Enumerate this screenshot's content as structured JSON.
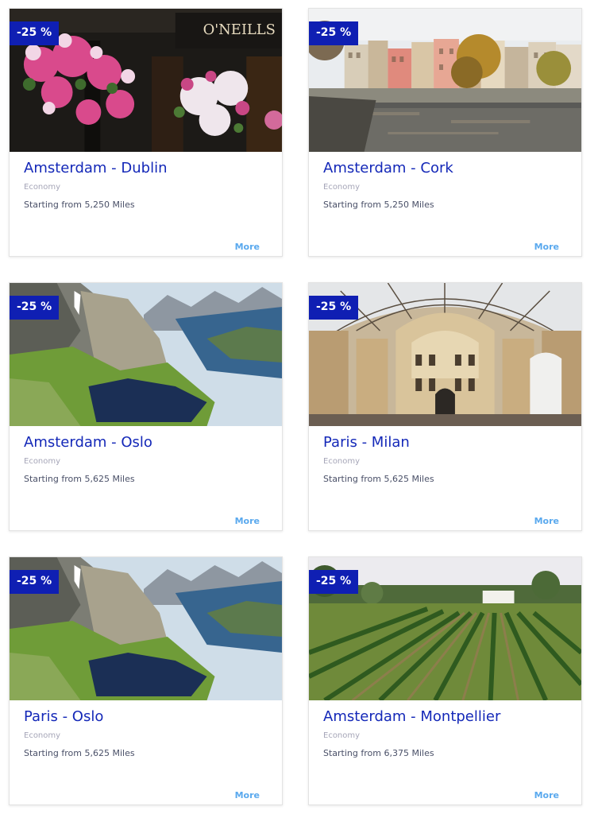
{
  "cards": [
    {
      "discount": "-25 %",
      "route": "Amsterdam - Dublin",
      "cabin": "Economy",
      "price": "Starting from 5,250 Miles",
      "more": "More",
      "sign": "O'NEILLS"
    },
    {
      "discount": "-25 %",
      "route": "Amsterdam - Cork",
      "cabin": "Economy",
      "price": "Starting from 5,250 Miles",
      "more": "More"
    },
    {
      "discount": "-25 %",
      "route": "Amsterdam - Oslo",
      "cabin": "Economy",
      "price": "Starting from 5,625 Miles",
      "more": "More"
    },
    {
      "discount": "-25 %",
      "route": "Paris - Milan",
      "cabin": "Economy",
      "price": "Starting from 5,625 Miles",
      "more": "More"
    },
    {
      "discount": "-25 %",
      "route": "Paris - Oslo",
      "cabin": "Economy",
      "price": "Starting from 5,625 Miles",
      "more": "More"
    },
    {
      "discount": "-25 %",
      "route": "Amsterdam - Montpellier",
      "cabin": "Economy",
      "price": "Starting from 6,375 Miles",
      "more": "More"
    }
  ],
  "colors": {
    "badge_bg": "#0f1fb3",
    "title": "#1428b8",
    "link": "#5aa9ee"
  }
}
